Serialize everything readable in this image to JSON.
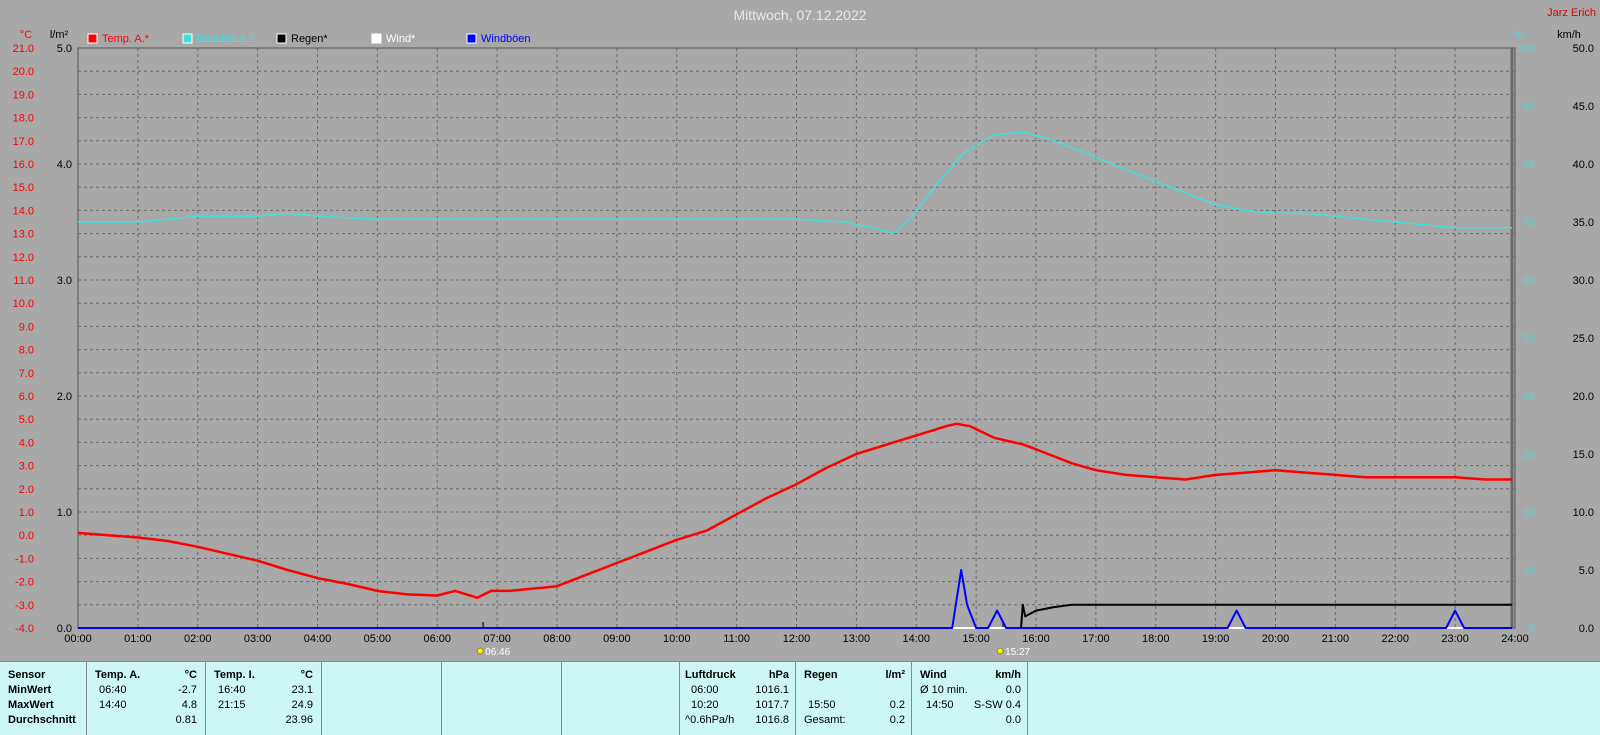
{
  "header": {
    "title": "Mittwoch, 07.12.2022",
    "author": "Jarz Erich"
  },
  "legend": [
    {
      "label": "Temp. A.*",
      "color": "#ff0000"
    },
    {
      "label": "Feuchte A.*",
      "color": "#40e0e0"
    },
    {
      "label": "Regen*",
      "color": "#000000"
    },
    {
      "label": "Wind*",
      "color": "#ffffff"
    },
    {
      "label": "Windböen",
      "color": "#0000ff"
    }
  ],
  "axes": {
    "temp_unit": "°C",
    "rain_unit": "l/m²",
    "humidity_unit": "%",
    "wind_unit": "km/h",
    "temp_ticks": [
      "21.0",
      "20.0",
      "19.0",
      "18.0",
      "17.0",
      "16.0",
      "15.0",
      "14.0",
      "13.0",
      "12.0",
      "11.0",
      "10.0",
      "9.0",
      "8.0",
      "7.0",
      "6.0",
      "5.0",
      "4.0",
      "3.0",
      "2.0",
      "1.0",
      "0.0",
      "-1.0",
      "-2.0",
      "-3.0",
      "-4.0"
    ],
    "rain_ticks": [
      "5.0",
      "4.0",
      "3.0",
      "2.0",
      "1.0",
      "0.0"
    ],
    "humidity_ticks": [
      "100",
      "90",
      "80",
      "70",
      "60",
      "50",
      "40",
      "30",
      "20",
      "10",
      "0"
    ],
    "wind_ticks": [
      "50.0",
      "45.0",
      "40.0",
      "35.0",
      "30.0",
      "25.0",
      "20.0",
      "15.0",
      "10.0",
      "5.0",
      "0.0"
    ],
    "time_ticks": [
      "00:00",
      "01:00",
      "02:00",
      "03:00",
      "04:00",
      "05:00",
      "06:00",
      "07:00",
      "08:00",
      "09:00",
      "10:00",
      "11:00",
      "12:00",
      "13:00",
      "14:00",
      "15:00",
      "16:00",
      "17:00",
      "18:00",
      "19:00",
      "20:00",
      "21:00",
      "22:00",
      "23:00",
      "24:00"
    ],
    "sunrise": "06:46",
    "sunset": "15:27"
  },
  "chart_data": {
    "type": "line",
    "title": "Mittwoch, 07.12.2022",
    "x_unit": "hour",
    "xlim": [
      0,
      24
    ],
    "y_axes": {
      "temperature": {
        "unit": "°C",
        "lim": [
          -4,
          21
        ]
      },
      "rain": {
        "unit": "l/m²",
        "lim": [
          0,
          5
        ]
      },
      "humidity": {
        "unit": "%",
        "lim": [
          0,
          100
        ]
      },
      "wind": {
        "unit": "km/h",
        "lim": [
          0,
          50
        ]
      }
    },
    "grid": true,
    "series": [
      {
        "name": "Temp. A.*",
        "axis": "temperature",
        "color": "#ff0000",
        "x": [
          0,
          0.5,
          1,
          1.5,
          2,
          2.5,
          3,
          3.5,
          4,
          4.5,
          5,
          5.5,
          6,
          6.3,
          6.67,
          6.9,
          7.2,
          7.6,
          8,
          8.5,
          9,
          9.5,
          10,
          10.5,
          11,
          11.5,
          12,
          12.5,
          13,
          13.5,
          14,
          14.5,
          14.67,
          14.9,
          15.3,
          15.8,
          16.2,
          16.6,
          17,
          17.5,
          18,
          18.5,
          19,
          19.5,
          20,
          20.5,
          21,
          21.5,
          22,
          22.5,
          23,
          23.5,
          23.95
        ],
        "y": [
          0.1,
          0,
          -0.1,
          -0.25,
          -0.5,
          -0.8,
          -1.1,
          -1.5,
          -1.85,
          -2.1,
          -2.4,
          -2.55,
          -2.6,
          -2.4,
          -2.7,
          -2.4,
          -2.4,
          -2.3,
          -2.2,
          -1.7,
          -1.2,
          -0.7,
          -0.2,
          0.2,
          0.9,
          1.6,
          2.2,
          2.9,
          3.5,
          3.9,
          4.3,
          4.7,
          4.8,
          4.7,
          4.2,
          3.9,
          3.5,
          3.1,
          2.8,
          2.6,
          2.5,
          2.4,
          2.6,
          2.7,
          2.8,
          2.7,
          2.6,
          2.5,
          2.5,
          2.5,
          2.5,
          2.4,
          2.4
        ]
      },
      {
        "name": "Feuchte A.*",
        "axis": "humidity",
        "color": "#40e0e0",
        "x": [
          0,
          1,
          2,
          3,
          3.5,
          4,
          5,
          6,
          7,
          8,
          9,
          10,
          11,
          12,
          12.8,
          13.3,
          13.6,
          13.9,
          14.3,
          14.8,
          15.3,
          15.8,
          16.3,
          16.8,
          17.5,
          18,
          18.5,
          19,
          19.5,
          20,
          20.5,
          21,
          22,
          22.5,
          23,
          23.95
        ],
        "y": [
          70,
          70,
          71,
          71,
          71.5,
          71,
          70.5,
          70.5,
          70.5,
          70.5,
          70.5,
          70.5,
          70.5,
          70.5,
          70,
          69,
          68,
          70.5,
          76,
          82,
          85,
          85.5,
          84,
          82,
          79,
          77,
          75,
          73,
          72,
          71.5,
          71.5,
          71,
          70,
          69.5,
          69,
          69
        ]
      },
      {
        "name": "Regen*",
        "axis": "rain",
        "color": "#000000",
        "x": [
          0,
          15.75,
          15.78,
          15.82,
          16,
          16.3,
          16.6,
          17,
          18,
          19,
          20,
          21,
          22,
          23,
          23.95
        ],
        "y": [
          0,
          0,
          0.2,
          0.1,
          0.15,
          0.18,
          0.2,
          0.2,
          0.2,
          0.2,
          0.2,
          0.2,
          0.2,
          0.2,
          0.2
        ]
      },
      {
        "name": "Wind*",
        "axis": "wind",
        "color": "#ffffff",
        "x": [
          0,
          23.95
        ],
        "y": [
          0,
          0
        ]
      },
      {
        "name": "Windböen",
        "axis": "wind",
        "color": "#0000ff",
        "x": [
          0,
          14.6,
          14.75,
          14.85,
          15,
          15.2,
          15.35,
          15.5,
          19.2,
          19.35,
          19.5,
          22.85,
          23,
          23.15,
          23.95
        ],
        "y": [
          0,
          0,
          5,
          2,
          0,
          0,
          1.5,
          0,
          0,
          1.5,
          0,
          0,
          1.5,
          0,
          0
        ]
      }
    ]
  },
  "stats": {
    "sensor": {
      "head": "Sensor",
      "rows": [
        "MinWert",
        "MaxWert",
        "Durchschnitt"
      ]
    },
    "temp_a": {
      "head": "Temp. A.",
      "unit": "°C",
      "min_time": "06:40",
      "min_val": "-2.7",
      "max_time": "14:40",
      "max_val": "4.8",
      "avg": "0.81"
    },
    "temp_i": {
      "head": "Temp. I.",
      "unit": "°C",
      "min_time": "16:40",
      "min_val": "23.1",
      "max_time": "21:15",
      "max_val": "24.9",
      "avg": "23.96"
    },
    "pressure": {
      "head": "Luftdruck",
      "unit": "hPa",
      "r1_label": "06:00",
      "r1_val": "1016.1",
      "r2_label": "10:20",
      "r2_val": "1017.7",
      "r3_label": "^0.6hPa/h",
      "r3_val": "1016.8"
    },
    "rain": {
      "head": "Regen",
      "unit": "l/m²",
      "r2_label": "15:50",
      "r2_val": "0.2",
      "r3_label": "Gesamt:",
      "r3_val": "0.2"
    },
    "wind": {
      "head": "Wind",
      "unit": "km/h",
      "r1_label": "Ø 10 min.",
      "r1_val": "0.0",
      "r2_label": "14:50",
      "r2_val": "S-SW 0.4",
      "r3_val": "0.0"
    }
  }
}
